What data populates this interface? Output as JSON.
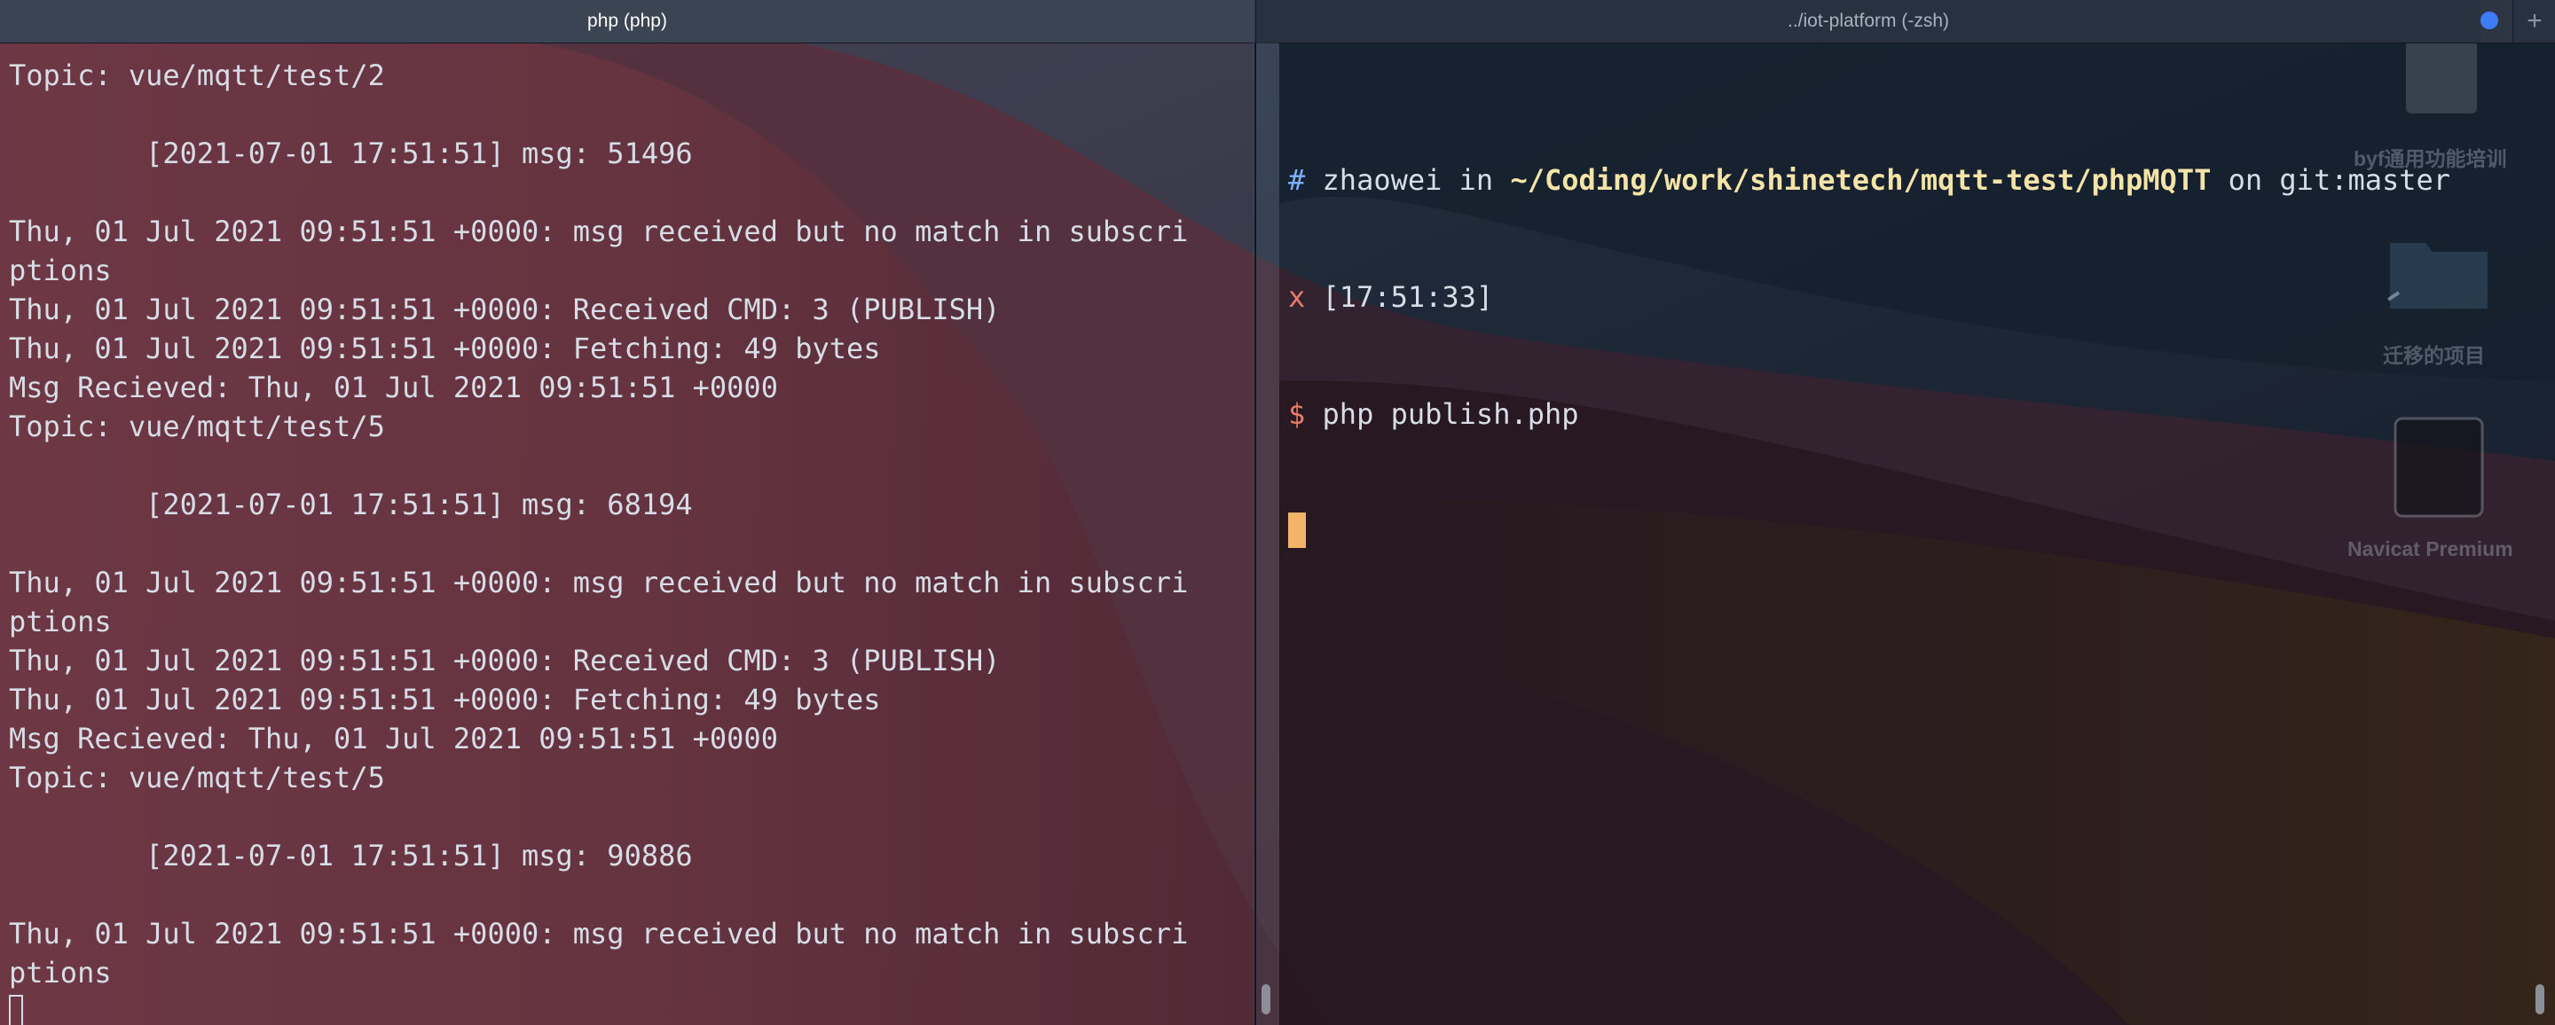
{
  "tabs": {
    "left": "php (php)",
    "right": "../iot-platform (-zsh)",
    "new_tab": "+"
  },
  "left_pane": {
    "lines": [
      "Topic: vue/mqtt/test/2",
      "",
      "        [2021-07-01 17:51:51] msg: 51496",
      "",
      "Thu, 01 Jul 2021 09:51:51 +0000: msg received but no match in subscri",
      "ptions",
      "Thu, 01 Jul 2021 09:51:51 +0000: Received CMD: 3 (PUBLISH)",
      "Thu, 01 Jul 2021 09:51:51 +0000: Fetching: 49 bytes",
      "Msg Recieved: Thu, 01 Jul 2021 09:51:51 +0000",
      "Topic: vue/mqtt/test/5",
      "",
      "        [2021-07-01 17:51:51] msg: 68194",
      "",
      "Thu, 01 Jul 2021 09:51:51 +0000: msg received but no match in subscri",
      "ptions",
      "Thu, 01 Jul 2021 09:51:51 +0000: Received CMD: 3 (PUBLISH)",
      "Thu, 01 Jul 2021 09:51:51 +0000: Fetching: 49 bytes",
      "Msg Recieved: Thu, 01 Jul 2021 09:51:51 +0000",
      "Topic: vue/mqtt/test/5",
      "",
      "        [2021-07-01 17:51:51] msg: 90886",
      "",
      "Thu, 01 Jul 2021 09:51:51 +0000: msg received but no match in subscri",
      "ptions"
    ]
  },
  "right_pane": {
    "prompt": {
      "hash": "#",
      "user": "zhaowei",
      "in": "in",
      "path": "~/Coding/work/shinetech/mqtt-test/phpMQTT",
      "on": "on",
      "git": "git:master",
      "status": "x",
      "time": "[17:51:33]",
      "dollar": "$",
      "command": "php publish.php"
    }
  },
  "desktop": {
    "icons": [
      {
        "label": "byf通用功能培训",
        "icon": "document-icon"
      },
      {
        "label": "迁移的项目",
        "icon": "folder-icon"
      },
      {
        "label": "Navicat Premium",
        "icon": "disk-icon"
      }
    ]
  },
  "colors": {
    "tab_active": "#3b4453",
    "tab_inactive": "#283140",
    "cursor_right": "#f2b36a",
    "path_yellow": "#f4e4a8",
    "prompt_red": "#e87b6a",
    "hash_blue": "#7fb0ff"
  }
}
